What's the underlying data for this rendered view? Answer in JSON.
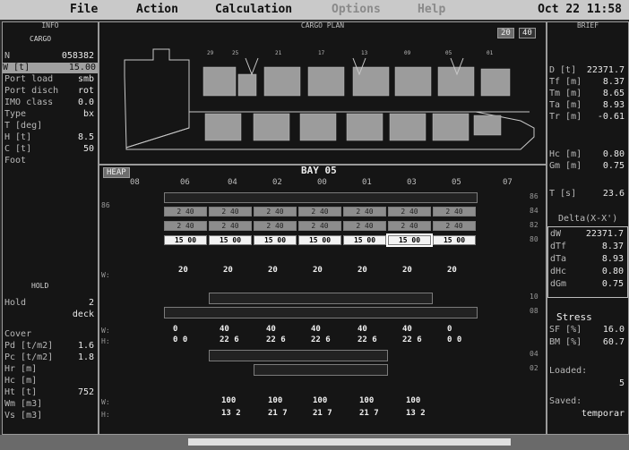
{
  "menu": {
    "file": "File",
    "action": "Action",
    "calculation": "Calculation",
    "options": "Options",
    "help": "Help",
    "clock": "Oct 22 11:58"
  },
  "info": {
    "title": "INFO",
    "subtitle": "CARGO",
    "id_label": "N",
    "id_value": "058382",
    "weight_label": "W [t]",
    "weight_value": "15.00",
    "port_load_label": "Port load",
    "port_load_value": "smb",
    "port_disch_label": "Port disch",
    "port_disch_value": "rot",
    "imo_label": "IMO class",
    "imo_value": "0.0",
    "type_label": "Type",
    "type_value": "bx",
    "t_label": "T [deg]",
    "t_value": "",
    "h_label": "H [t]",
    "h_value": "8.5",
    "c_label": "C [t]",
    "c_value": "50",
    "foot_label": "Foot",
    "hold_title": "HOLD",
    "hold_label": "Hold",
    "hold_value": "2",
    "hold_sub": "deck",
    "cover_label": "Cover",
    "pd_label": "Pd [t/m2]",
    "pd_value": "1.6",
    "pc_label": "Pc [t/m2]",
    "pc_value": "1.8",
    "hr_label": "Hr [m]",
    "hc_label": "Hc [m]",
    "ht_label": "Ht [t]",
    "ht_value": "752",
    "wm_label": "Wm [m3]",
    "vs_label": "Vs [m3]"
  },
  "plan": {
    "title": "CARGO PLAN",
    "btn_20": "20",
    "btn_40": "40",
    "bay_numbers": [
      "29",
      "25",
      "21",
      "17",
      "13",
      "09",
      "05",
      "01"
    ]
  },
  "bay": {
    "heap_button": "HEAP",
    "title": "BAY 05",
    "cols": [
      "06",
      "04",
      "02",
      "00",
      "01",
      "03",
      "05",
      "07"
    ],
    "left_col": "08",
    "row_labels": [
      "86",
      "84",
      "82",
      "80"
    ],
    "deck_weights": [
      "2 40",
      "2 40",
      "2 40",
      "2 40",
      "2 40",
      "2 40",
      "2 40"
    ],
    "deck_weights_b": [
      "2 40",
      "2 40",
      "2 40",
      "2 40",
      "2 40",
      "2 40",
      "2 40"
    ],
    "selected": [
      "15 00",
      "15 00",
      "15 00",
      "15 00",
      "15 00",
      "15 00",
      "15 00"
    ],
    "sum_deck": [
      "20",
      "20",
      "20",
      "20",
      "20",
      "20",
      "20"
    ],
    "hold_tier_a": [
      "0",
      "40",
      "40",
      "40",
      "40",
      "40",
      "0"
    ],
    "hold_tier_b": [
      "0 0",
      "22 6",
      "22 6",
      "22 6",
      "22 6",
      "22 6",
      "0 0"
    ],
    "hold_tier_c": [
      "100",
      "100",
      "100",
      "100",
      "100"
    ],
    "hold_tier_d": [
      "13 2",
      "21 7",
      "21 7",
      "21 7",
      "13 2"
    ],
    "side_labels": [
      "W:",
      "H:"
    ],
    "right_labels": [
      "10",
      "08",
      "04",
      "02"
    ]
  },
  "brief": {
    "title": "BRIEF",
    "d_label": "D [t]",
    "d_value": "22371.7",
    "tf_label": "Tf [m]",
    "tf_value": "8.37",
    "tm_label": "Tm [m]",
    "tm_value": "8.65",
    "ta_label": "Ta [m]",
    "ta_value": "8.93",
    "tr_label": "Tr [m]",
    "tr_value": "-0.61",
    "hc_label": "Hc [m]",
    "hc_value": "0.80",
    "gm_label": "Gm [m]",
    "gm_value": "0.75",
    "t_label": "T [s]",
    "t_value": "23.6",
    "delta_title": "Delta(X-X')",
    "dw_label": "dW",
    "dw_value": "22371.7",
    "dtf_label": "dTf",
    "dtf_value": "8.37",
    "dta_label": "dTa",
    "dta_value": "8.93",
    "dhc_label": "dHc",
    "dhc_value": "0.80",
    "dgm_label": "dGm",
    "dgm_value": "0.75",
    "stress_title": "Stress",
    "sf_label": "SF [%]",
    "sf_value": "16.0",
    "bm_label": "BM [%]",
    "bm_value": "60.7",
    "loaded_label": "Loaded:",
    "loaded_value": "5",
    "saved_label": "Saved:",
    "saved_value": "temporar"
  },
  "colors": {
    "background": "#151515",
    "menubar": "#c9c9c9",
    "container": "#9c9c9c",
    "selected": "#f2f2f2"
  }
}
